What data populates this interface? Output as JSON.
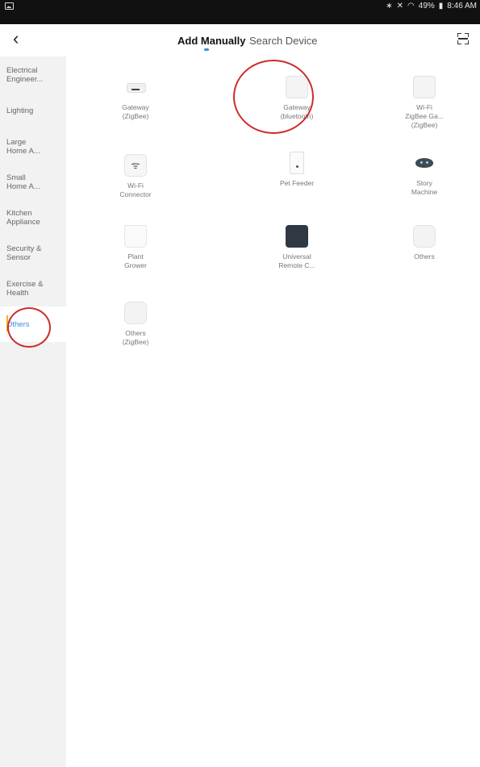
{
  "status_bar": {
    "right_text": "49%",
    "time": "8:46 AM",
    "icons": [
      "picture-icon",
      "bluetooth-icon",
      "mute-icon",
      "wifi-icon",
      "battery-icon"
    ]
  },
  "header": {
    "back_glyph": "‹",
    "tabs": [
      {
        "label": "Add Manually",
        "active": true
      },
      {
        "label": "Search Device",
        "active": false
      }
    ],
    "accent_color": "#3a8be6"
  },
  "sidebar": {
    "items": [
      {
        "label": "Electrical\nEngineer..."
      },
      {
        "label": "Lighting"
      },
      {
        "label": "Large\nHome A..."
      },
      {
        "label": "Small\nHome A..."
      },
      {
        "label": "Kitchen\nAppliance"
      },
      {
        "label": "Security &\nSensor"
      },
      {
        "label": "Exercise &\nHealth"
      },
      {
        "label": "Others",
        "active": true
      }
    ]
  },
  "devices": [
    {
      "label": "Gateway\n(ZigBee)",
      "icon": "gateway-zigbee-icon"
    },
    {
      "label": "Gateway\n(bluetooth)",
      "icon": "gateway-bluetooth-icon"
    },
    {
      "label": "Wi-Fi\nZigBee Ga...\n(ZigBee)",
      "icon": "wifi-zigbee-gateway-icon"
    },
    {
      "label": "Wi-Fi\nConnector",
      "icon": "wifi-connector-icon"
    },
    {
      "label": "Pet Feeder",
      "icon": "pet-feeder-icon"
    },
    {
      "label": "Story\nMachine",
      "icon": "story-machine-icon"
    },
    {
      "label": "Plant\nGrower",
      "icon": "plant-grower-icon"
    },
    {
      "label": "Universal\nRemote C...",
      "icon": "universal-remote-icon"
    },
    {
      "label": "Others",
      "icon": "others-icon"
    },
    {
      "label": "Others\n(ZigBee)",
      "icon": "others-zigbee-icon"
    }
  ],
  "highlight_color": "#cf2b2b"
}
